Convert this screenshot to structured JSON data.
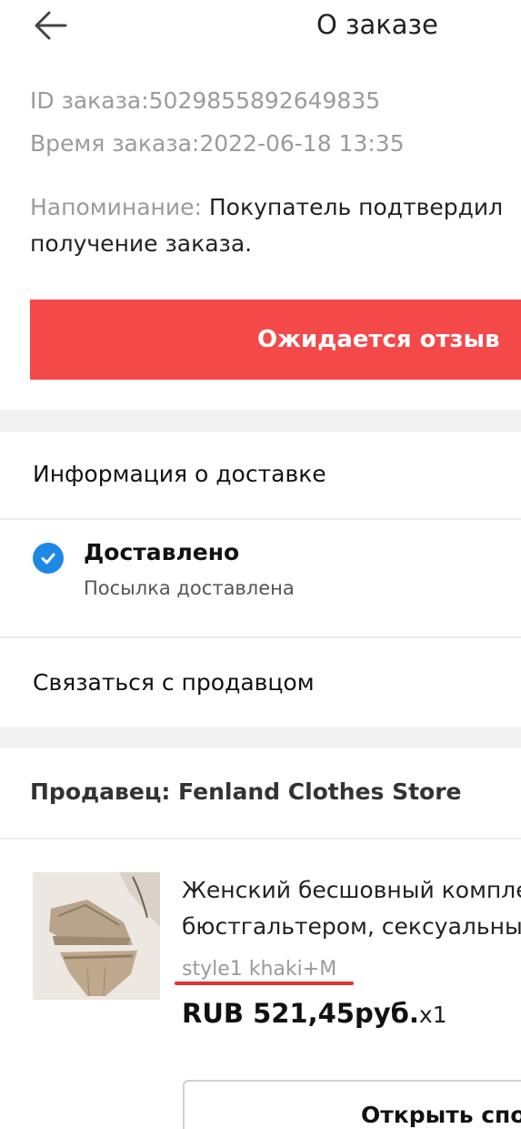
{
  "header": {
    "back_icon": "arrow-left-icon",
    "title": "О заказе"
  },
  "order": {
    "id_text": "ID заказа:5029855892649835",
    "time_text": "Время заказа:2022-06-18 13:35",
    "reminder_label": "Напоминание:",
    "reminder_text": " Покупатель подтвердил получение заказа."
  },
  "status_banner": {
    "label": "Ожидается отзыв",
    "color": "#f44949"
  },
  "delivery": {
    "section_title": "Информация о доставке",
    "status_icon": "check-circle-icon",
    "status_title": "Доставлено",
    "status_subtitle": "Посылка доставлена",
    "accent_color": "#1e88e5"
  },
  "contact": {
    "label": "Связаться с продавцом"
  },
  "seller": {
    "label": "Продавец: Fenland Clothes Store"
  },
  "product": {
    "image": "lingerie-set-photo",
    "title_line1": "Женский бесшовный комплект",
    "title_line2": "бюстгальтером, сексуальный",
    "variant": "style1 khaki+M",
    "price": "RUB 521,45руб.",
    "quantity": "x1"
  },
  "actions": {
    "open_dispute_label": "Открыть спор"
  }
}
